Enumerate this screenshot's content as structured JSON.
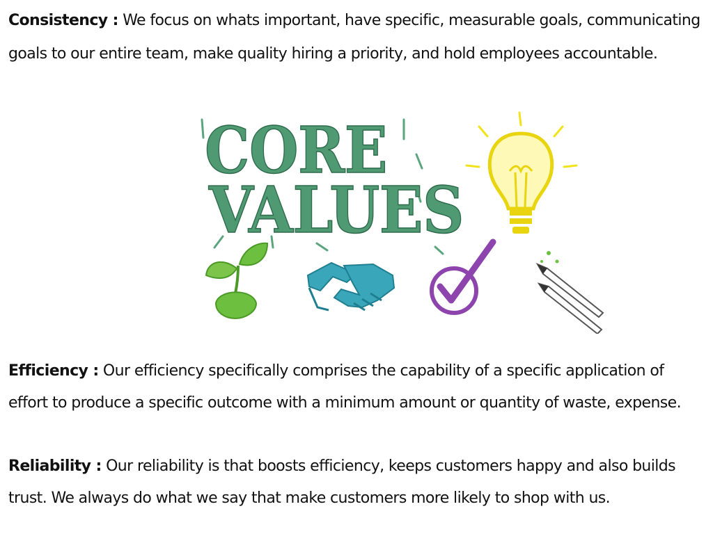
{
  "consistency": {
    "term": "Consistency :",
    "text": " We focus on whats important, have specific, measurable goals, communicating goals to our entire team, make quality hiring a priority, and hold employees accountable."
  },
  "illustration": {
    "line1": "CORE",
    "line2": "VALUES",
    "icons": [
      "sprout-icon",
      "handshake-icon",
      "checkmark-icon",
      "lightbulb-icon",
      "pencils-icon"
    ],
    "colors": {
      "lettering": "#4f9a73",
      "sprout": "#6cbf3f",
      "handshake": "#3aa6b9",
      "check": "#8e44ad",
      "bulb": "#f2e21a"
    }
  },
  "efficiency": {
    "term": "Efficiency :",
    "text": " Our efficiency specifically comprises the capability of a specific  application of effort to produce a specific outcome with a minimum amount or quantity of waste, expense."
  },
  "reliability": {
    "term": "Reliability :",
    "text": " Our reliability is that boosts efficiency, keeps customers happy and also builds trust. We always do what we say that make customers more likely to shop with us."
  }
}
